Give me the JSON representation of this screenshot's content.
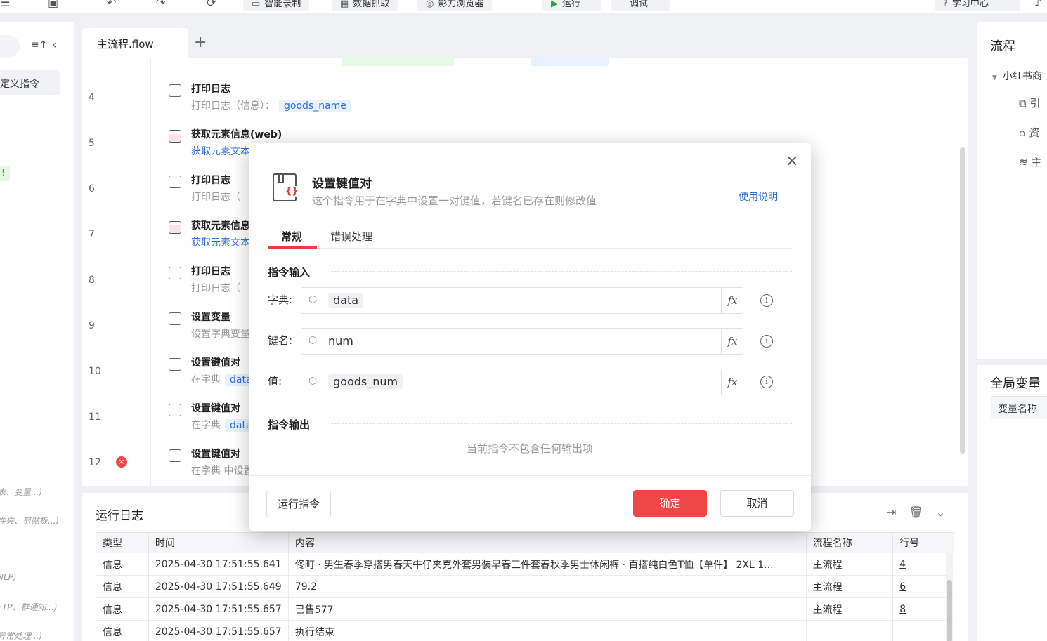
{
  "toolbar": {
    "smart_record": "智能录制",
    "data_capture": "数据抓取",
    "browser": "影刀浏览器",
    "run": "运行",
    "debug": "调试",
    "learning_center": "学习中心"
  },
  "sidebar": {
    "selected_item": "定义指令",
    "badge": "!",
    "hints": [
      "表、变量...)",
      "件夹、剪贴板...)",
      "NLP)",
      "FTP、群通知...)",
      "异常处理...)"
    ]
  },
  "editor": {
    "tab_label": "主流程.flow",
    "add_tab": "+",
    "rows": [
      {
        "line": "4",
        "title": "打印日志",
        "sub_prefix": "打印日志（信息）：",
        "chip": "goods_name",
        "sub_link": false
      },
      {
        "line": "5",
        "title": "获取元素信息(web)",
        "sub_prefix": "获取元素文本",
        "chip": "",
        "sub_link": true
      },
      {
        "line": "6",
        "title": "打印日志",
        "sub_prefix": "打印日志（",
        "chip": "",
        "sub_link": false
      },
      {
        "line": "7",
        "title": "获取元素信息",
        "sub_prefix": "获取元素文本",
        "chip": "",
        "sub_link": true
      },
      {
        "line": "8",
        "title": "打印日志",
        "sub_prefix": "打印日志（",
        "chip": "",
        "sub_link": false
      },
      {
        "line": "9",
        "title": "设置变量",
        "sub_prefix": "设置字典变量",
        "chip": "",
        "sub_link": false
      },
      {
        "line": "10",
        "title": "设置键值对",
        "sub_prefix": "在字典",
        "chip": "data",
        "sub_link": false
      },
      {
        "line": "11",
        "title": "设置键值对",
        "sub_prefix": "在字典",
        "chip": "data",
        "sub_link": false
      },
      {
        "line": "12",
        "title": "设置键值对",
        "sub_prefix": "在字典 中设置",
        "chip": "",
        "sub_link": false
      }
    ],
    "error_mark": "×"
  },
  "log": {
    "title": "运行日志",
    "columns": [
      "类型",
      "时间",
      "内容",
      "流程名称",
      "行号"
    ],
    "rows": [
      {
        "type": "信息",
        "time": "2025-04-30 17:51:55.641",
        "content": "佟町 · 男生春季穿搭男春天牛仔夹克外套男装早春三件套春秋季男士休闲裤 · 百搭纯白色T恤【单件】 2XL 1...",
        "flow": "主流程",
        "line": "4"
      },
      {
        "type": "信息",
        "time": "2025-04-30 17:51:55.649",
        "content": "79.2",
        "flow": "主流程",
        "line": "6"
      },
      {
        "type": "信息",
        "time": "2025-04-30 17:51:55.657",
        "content": "已售577",
        "flow": "主流程",
        "line": "8"
      },
      {
        "type": "信息",
        "time": "2025-04-30 17:51:55.657",
        "content": "执行结束",
        "flow": "",
        "line": ""
      }
    ]
  },
  "right_panel": {
    "title": "流程",
    "tree_root": "小红书商",
    "items": [
      "引",
      "资",
      "主"
    ],
    "global_vars_title": "全局变量",
    "var_column": "变量名称"
  },
  "modal": {
    "title": "设置键值对",
    "description": "这个指令用于在字典中设置一对键值，若键名已存在则修改值",
    "help_link": "使用说明",
    "tabs": [
      "常规",
      "错误处理"
    ],
    "input_section": "指令输入",
    "output_section": "指令输出",
    "fields": [
      {
        "label": "字典:",
        "value": "data",
        "style": "tag"
      },
      {
        "label": "键名:",
        "value": "num",
        "style": "plain"
      },
      {
        "label": "值:",
        "value": "goods_num",
        "style": "tag"
      }
    ],
    "fx_label": "fx",
    "info_label": "i",
    "no_output": "当前指令不包含任何输出项",
    "run_button": "运行指令",
    "ok_button": "确定",
    "cancel_button": "取消",
    "close": "×"
  },
  "colors": {
    "accent_red": "#f04848",
    "link_blue": "#2f6fdc"
  }
}
